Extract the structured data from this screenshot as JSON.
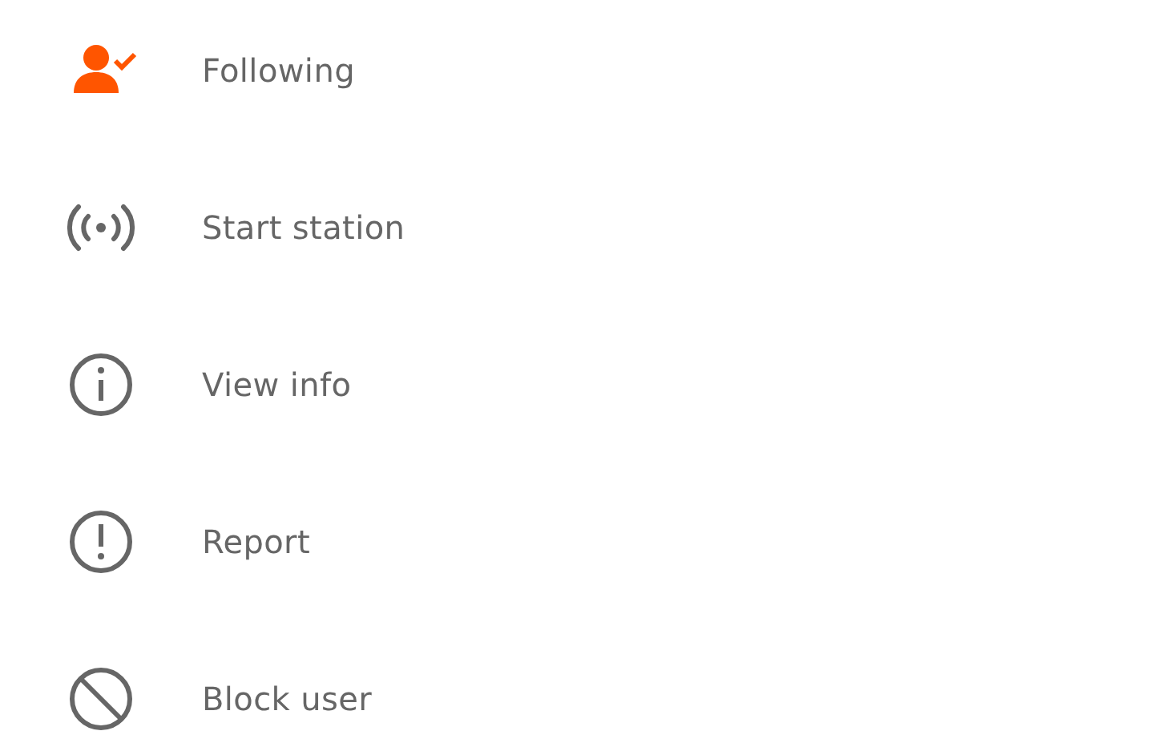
{
  "menu": {
    "items": [
      {
        "kind": "follow",
        "label": "Following",
        "active": true
      },
      {
        "kind": "station",
        "label": "Start station",
        "active": false
      },
      {
        "kind": "info",
        "label": "View info",
        "active": false
      },
      {
        "kind": "report",
        "label": "Report",
        "active": false
      },
      {
        "kind": "block",
        "label": "Block user",
        "active": false
      }
    ]
  }
}
